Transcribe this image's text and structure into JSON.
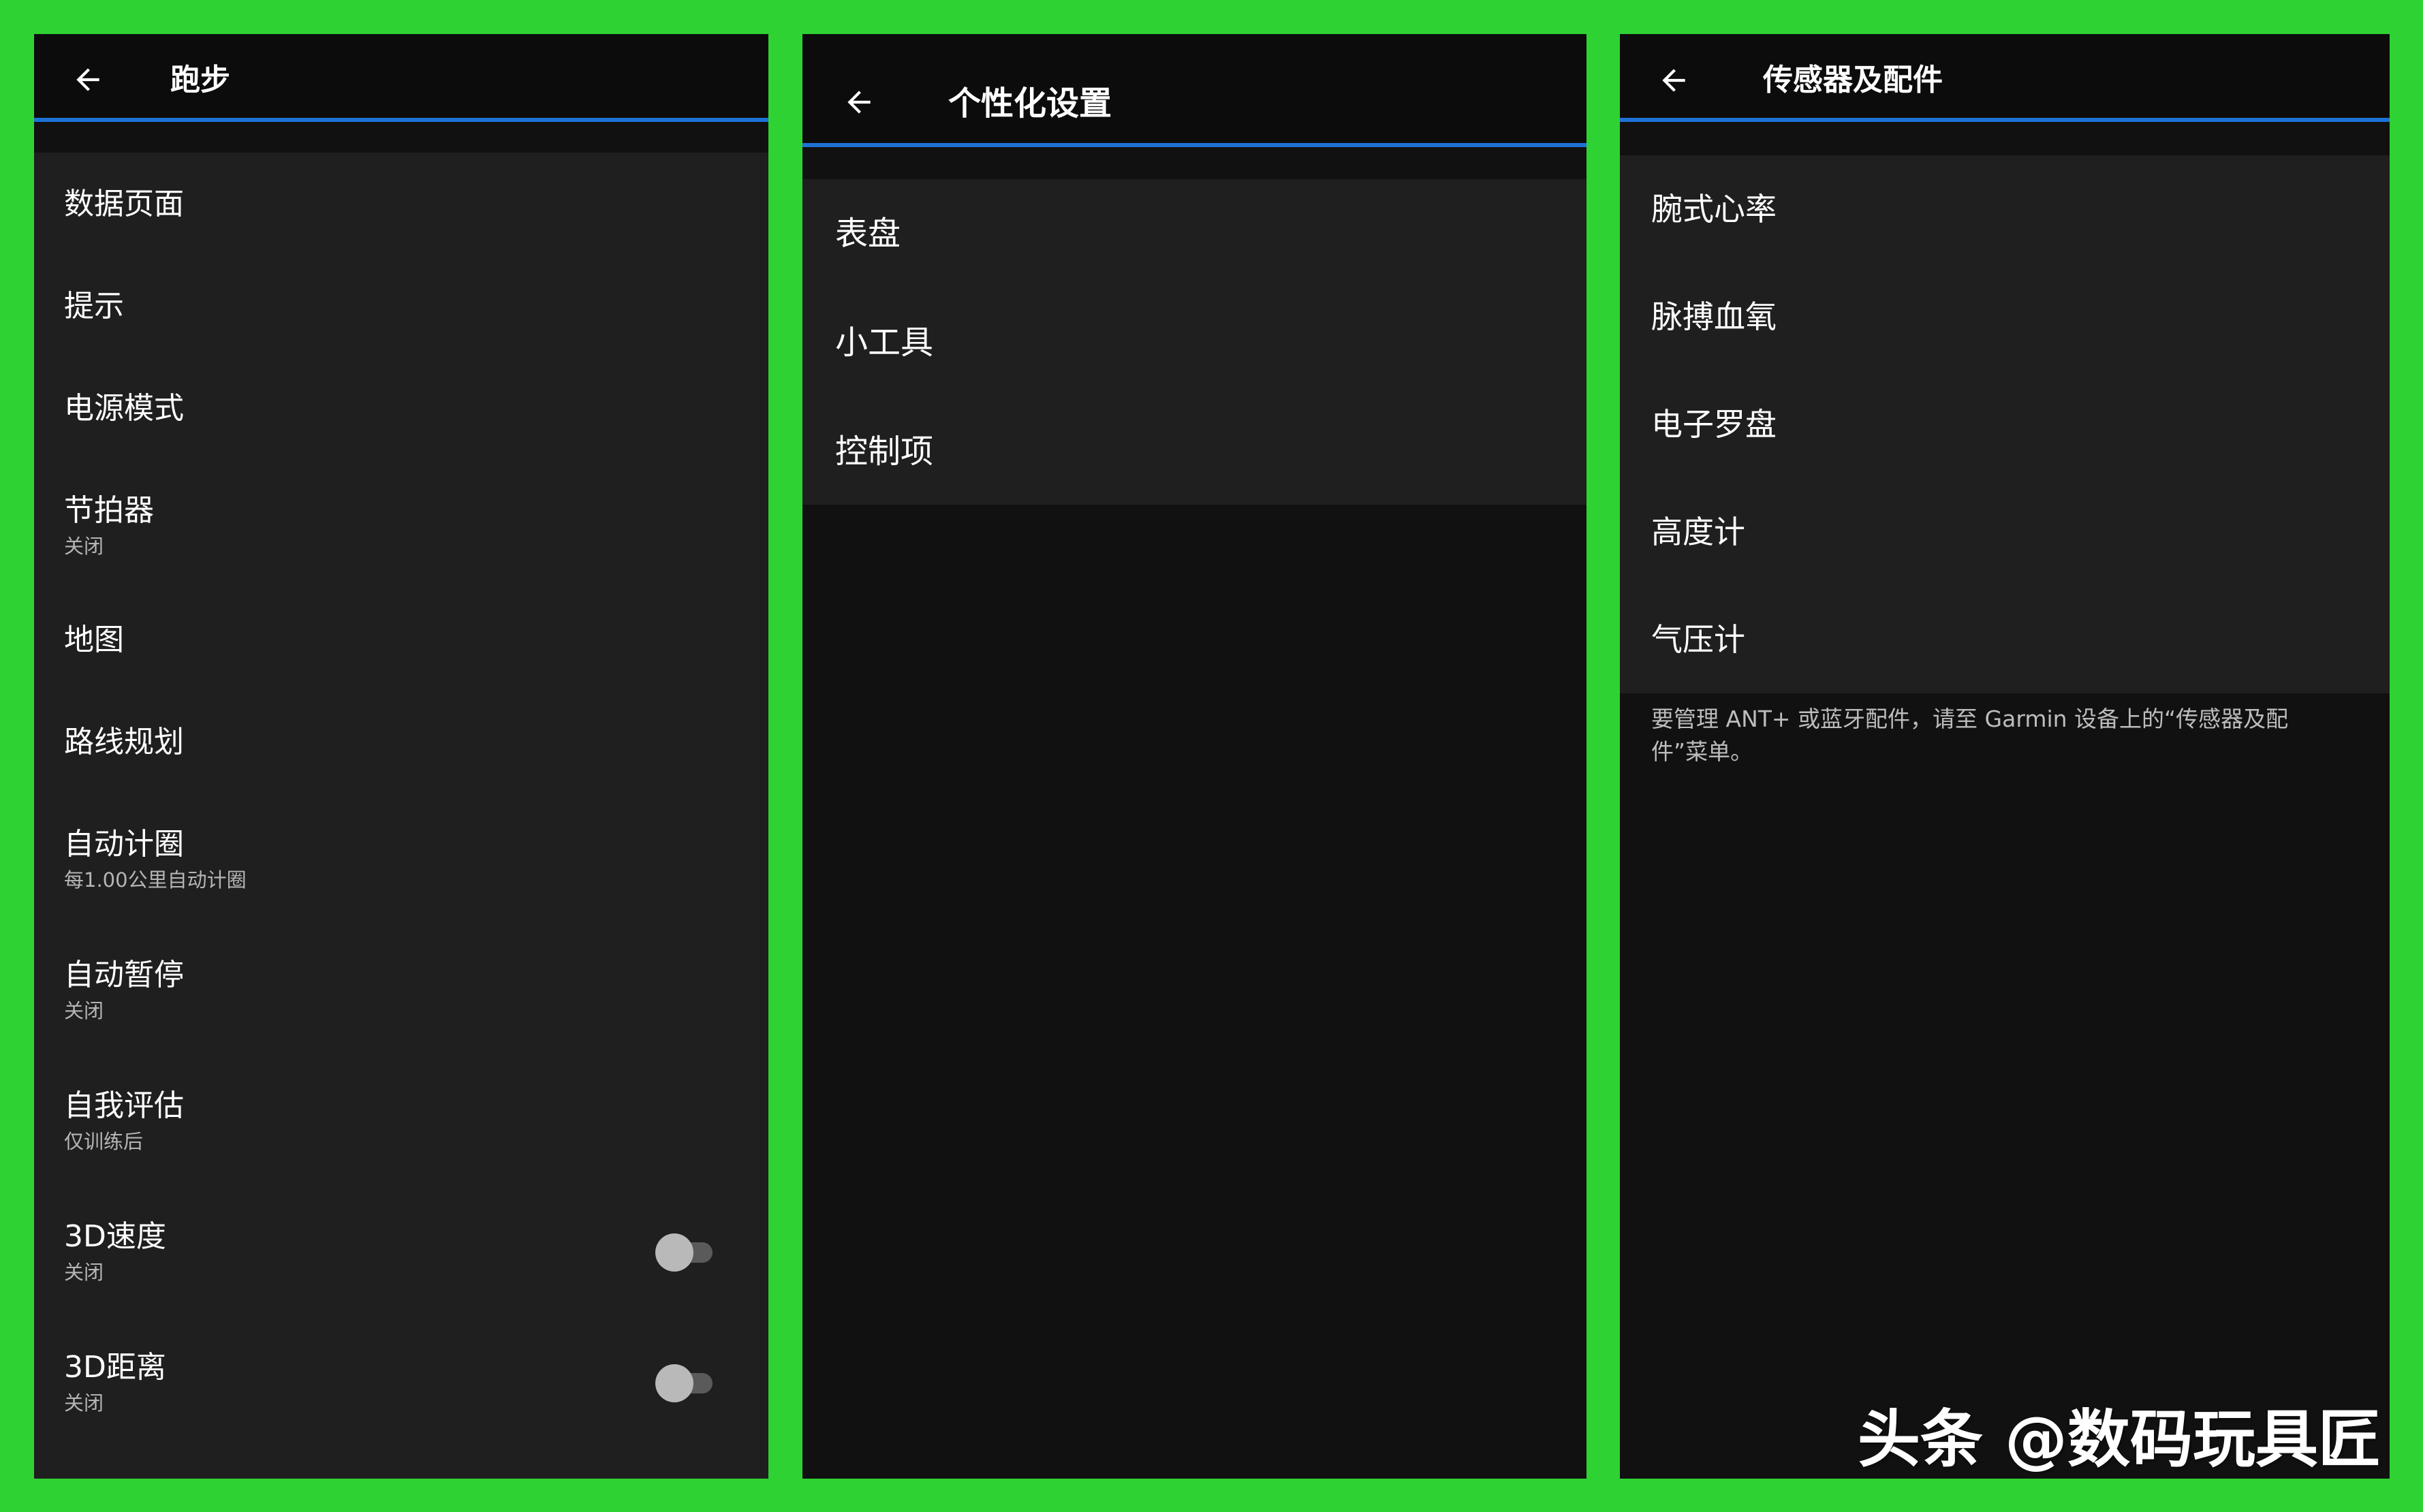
{
  "background_color": "#2fd233",
  "accent_color": "#1e72d6",
  "panels": {
    "running": {
      "title": "跑步",
      "back_icon": "arrow-left-icon",
      "items": [
        {
          "label": "数据页面",
          "sub": ""
        },
        {
          "label": "提示",
          "sub": ""
        },
        {
          "label": "电源模式",
          "sub": ""
        },
        {
          "label": "节拍器",
          "sub": "关闭"
        },
        {
          "label": "地图",
          "sub": ""
        },
        {
          "label": "路线规划",
          "sub": ""
        },
        {
          "label": "自动计圈",
          "sub": "每1.00公里自动计圈"
        },
        {
          "label": "自动暂停",
          "sub": "关闭"
        },
        {
          "label": "自我评估",
          "sub": "仅训练后"
        },
        {
          "label": "3D速度",
          "sub": "关闭",
          "toggle": false
        },
        {
          "label": "3D距离",
          "sub": "关闭",
          "toggle": false
        }
      ]
    },
    "customize": {
      "title": "个性化设置",
      "back_icon": "arrow-left-icon",
      "items": [
        {
          "label": "表盘"
        },
        {
          "label": "小工具"
        },
        {
          "label": "控制项"
        }
      ]
    },
    "sensors": {
      "title": "传感器及配件",
      "back_icon": "arrow-left-icon",
      "items": [
        {
          "label": "腕式心率"
        },
        {
          "label": "脉搏血氧"
        },
        {
          "label": "电子罗盘"
        },
        {
          "label": "高度计"
        },
        {
          "label": "气压计"
        }
      ],
      "footnote": "要管理 ANT+ 或蓝牙配件，请至 Garmin 设备上的“传感器及配件”菜单。"
    }
  },
  "watermark": "头条 @数码玩具匠"
}
